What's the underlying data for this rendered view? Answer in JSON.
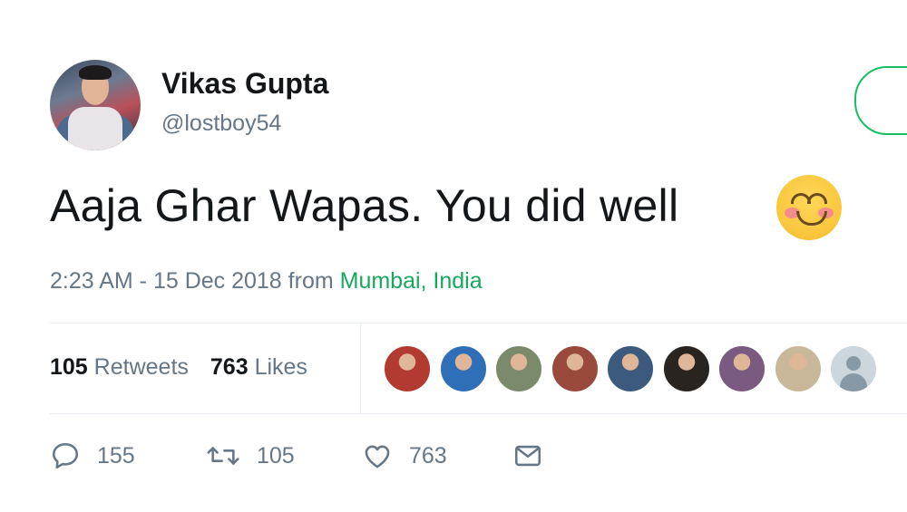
{
  "user": {
    "display_name": "Vikas Gupta",
    "handle": "@lostboy54"
  },
  "tweet": {
    "text": "Aaja Ghar Wapas. You did well",
    "emoji": "smiling-face-with-smiling-eyes-icon",
    "time": "2:23 AM - 15 Dec 2018",
    "from_label": "from",
    "location": "Mumbai, India"
  },
  "stats": {
    "retweets_count": "105",
    "retweets_label": "Retweets",
    "likes_count": "763",
    "likes_label": "Likes"
  },
  "likers": [
    {
      "icon": "liker-avatar-icon",
      "color": "#b23a30"
    },
    {
      "icon": "liker-avatar-icon",
      "color": "#2f6fb7"
    },
    {
      "icon": "liker-avatar-icon",
      "color": "#7a8a6a"
    },
    {
      "icon": "liker-avatar-icon",
      "color": "#9a4a3c"
    },
    {
      "icon": "liker-avatar-icon",
      "color": "#3b5a7e"
    },
    {
      "icon": "liker-avatar-icon",
      "color": "#2a2420"
    },
    {
      "icon": "liker-avatar-icon",
      "color": "#7a5a80"
    },
    {
      "icon": "liker-avatar-icon",
      "color": "#c9b79a"
    },
    {
      "icon": "default-avatar-icon",
      "color": "#ccd6dd"
    }
  ],
  "actions": {
    "reply_count": "155",
    "retweet_count": "105",
    "like_count": "763"
  },
  "colors": {
    "text": "#14171a",
    "secondary": "#657786",
    "location_link": "#17a85e",
    "follow_border": "#17bf63",
    "divider": "#e6ecf0"
  }
}
